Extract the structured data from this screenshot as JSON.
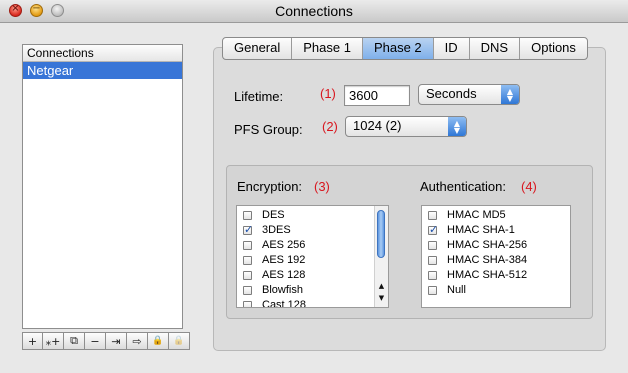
{
  "window": {
    "title": "Connections"
  },
  "connections": {
    "header": "Connections",
    "items": [
      {
        "label": "Netgear",
        "selected": true
      }
    ]
  },
  "toolbar_icons": [
    "add-icon",
    "wand-add-icon",
    "duplicate-icon",
    "remove-icon",
    "import-icon",
    "export-icon",
    "lock-icon",
    "lock-disabled-icon"
  ],
  "toolbar_glyphs": {
    "add": "+",
    "wand": "⁎+",
    "duplicate": "⧉",
    "remove": "−",
    "import": "⇥",
    "export": "⇨",
    "lock": "🔒",
    "lock2": "🔒"
  },
  "tabs": [
    {
      "label": "General"
    },
    {
      "label": "Phase 1"
    },
    {
      "label": "Phase 2",
      "selected": true
    },
    {
      "label": "ID"
    },
    {
      "label": "DNS"
    },
    {
      "label": "Options"
    }
  ],
  "lifetime": {
    "label": "Lifetime:",
    "marker": "(1)",
    "value": "3600",
    "unit": "Seconds"
  },
  "pfs": {
    "label": "PFS Group:",
    "marker": "(2)",
    "value": "1024 (2)"
  },
  "encryption": {
    "label": "Encryption:",
    "marker": "(3)",
    "items": [
      {
        "label": "DES",
        "checked": false
      },
      {
        "label": "3DES",
        "checked": true
      },
      {
        "label": "AES 256",
        "checked": false
      },
      {
        "label": "AES 192",
        "checked": false
      },
      {
        "label": "AES 128",
        "checked": false
      },
      {
        "label": "Blowfish",
        "checked": false
      },
      {
        "label": "Cast 128",
        "checked": false
      }
    ]
  },
  "authentication": {
    "label": "Authentication:",
    "marker": "(4)",
    "items": [
      {
        "label": "HMAC MD5",
        "checked": false
      },
      {
        "label": "HMAC SHA-1",
        "checked": true
      },
      {
        "label": "HMAC SHA-256",
        "checked": false
      },
      {
        "label": "HMAC SHA-384",
        "checked": false
      },
      {
        "label": "HMAC SHA-512",
        "checked": false
      },
      {
        "label": "Null",
        "checked": false
      }
    ]
  },
  "colors": {
    "accent": "#3875d7",
    "marker": "#d8171f",
    "tab_selected": "#8fb8ec"
  }
}
